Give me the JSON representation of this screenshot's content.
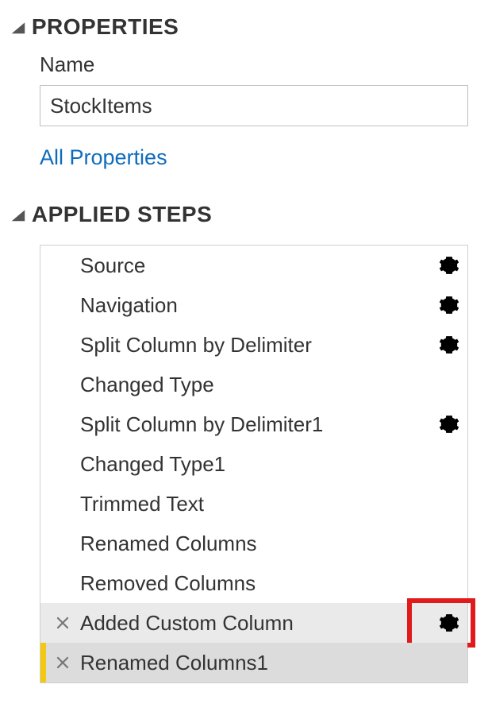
{
  "properties": {
    "header": "PROPERTIES",
    "name_label": "Name",
    "name_value": "StockItems",
    "all_properties_link": "All Properties"
  },
  "applied_steps": {
    "header": "APPLIED STEPS",
    "steps": [
      {
        "label": "Source",
        "has_gear": true,
        "deletable": false,
        "selected": "none",
        "gear_highlighted": false
      },
      {
        "label": "Navigation",
        "has_gear": true,
        "deletable": false,
        "selected": "none",
        "gear_highlighted": false
      },
      {
        "label": "Split Column by Delimiter",
        "has_gear": true,
        "deletable": false,
        "selected": "none",
        "gear_highlighted": false
      },
      {
        "label": "Changed Type",
        "has_gear": false,
        "deletable": false,
        "selected": "none",
        "gear_highlighted": false
      },
      {
        "label": "Split Column by Delimiter1",
        "has_gear": true,
        "deletable": false,
        "selected": "none",
        "gear_highlighted": false
      },
      {
        "label": "Changed Type1",
        "has_gear": false,
        "deletable": false,
        "selected": "none",
        "gear_highlighted": false
      },
      {
        "label": "Trimmed Text",
        "has_gear": false,
        "deletable": false,
        "selected": "none",
        "gear_highlighted": false
      },
      {
        "label": "Renamed Columns",
        "has_gear": false,
        "deletable": false,
        "selected": "none",
        "gear_highlighted": false
      },
      {
        "label": "Removed Columns",
        "has_gear": false,
        "deletable": false,
        "selected": "none",
        "gear_highlighted": false
      },
      {
        "label": "Added Custom Column",
        "has_gear": true,
        "deletable": true,
        "selected": "light",
        "gear_highlighted": true
      },
      {
        "label": "Renamed Columns1",
        "has_gear": false,
        "deletable": true,
        "selected": "dark",
        "gear_highlighted": false
      }
    ]
  },
  "icons": {
    "collapse": "◢",
    "gear": "gear-icon",
    "delete": "delete-step-icon"
  }
}
